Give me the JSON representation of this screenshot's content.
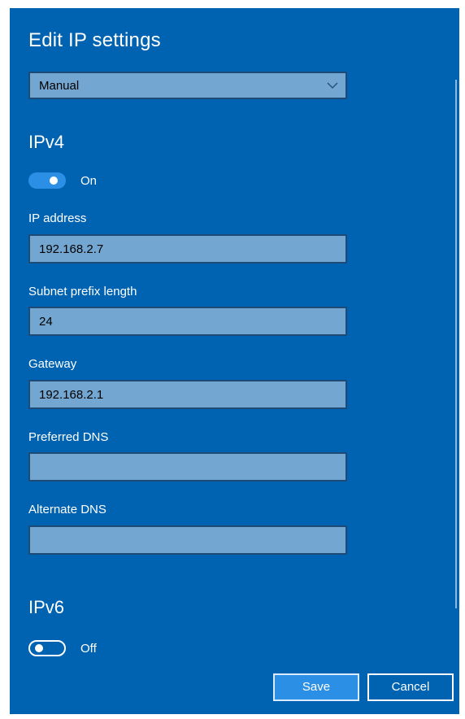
{
  "dialog": {
    "title": "Edit IP settings",
    "mode_select": {
      "value": "Manual",
      "icon": "chevron-down-icon"
    }
  },
  "ipv4": {
    "heading": "IPv4",
    "toggle_state": "On",
    "fields": {
      "ip_address": {
        "label": "IP address",
        "value": "192.168.2.7"
      },
      "subnet_prefix_length": {
        "label": "Subnet prefix length",
        "value": "24"
      },
      "gateway": {
        "label": "Gateway",
        "value": "192.168.2.1"
      },
      "preferred_dns": {
        "label": "Preferred DNS",
        "value": ""
      },
      "alternate_dns": {
        "label": "Alternate DNS",
        "value": ""
      }
    }
  },
  "ipv6": {
    "heading": "IPv6",
    "toggle_state": "Off"
  },
  "buttons": {
    "save": "Save",
    "cancel": "Cancel"
  },
  "colors": {
    "dialog_bg": "#0063b1",
    "input_bg": "#73a6d1",
    "toggle_on": "#2b8fe6"
  }
}
